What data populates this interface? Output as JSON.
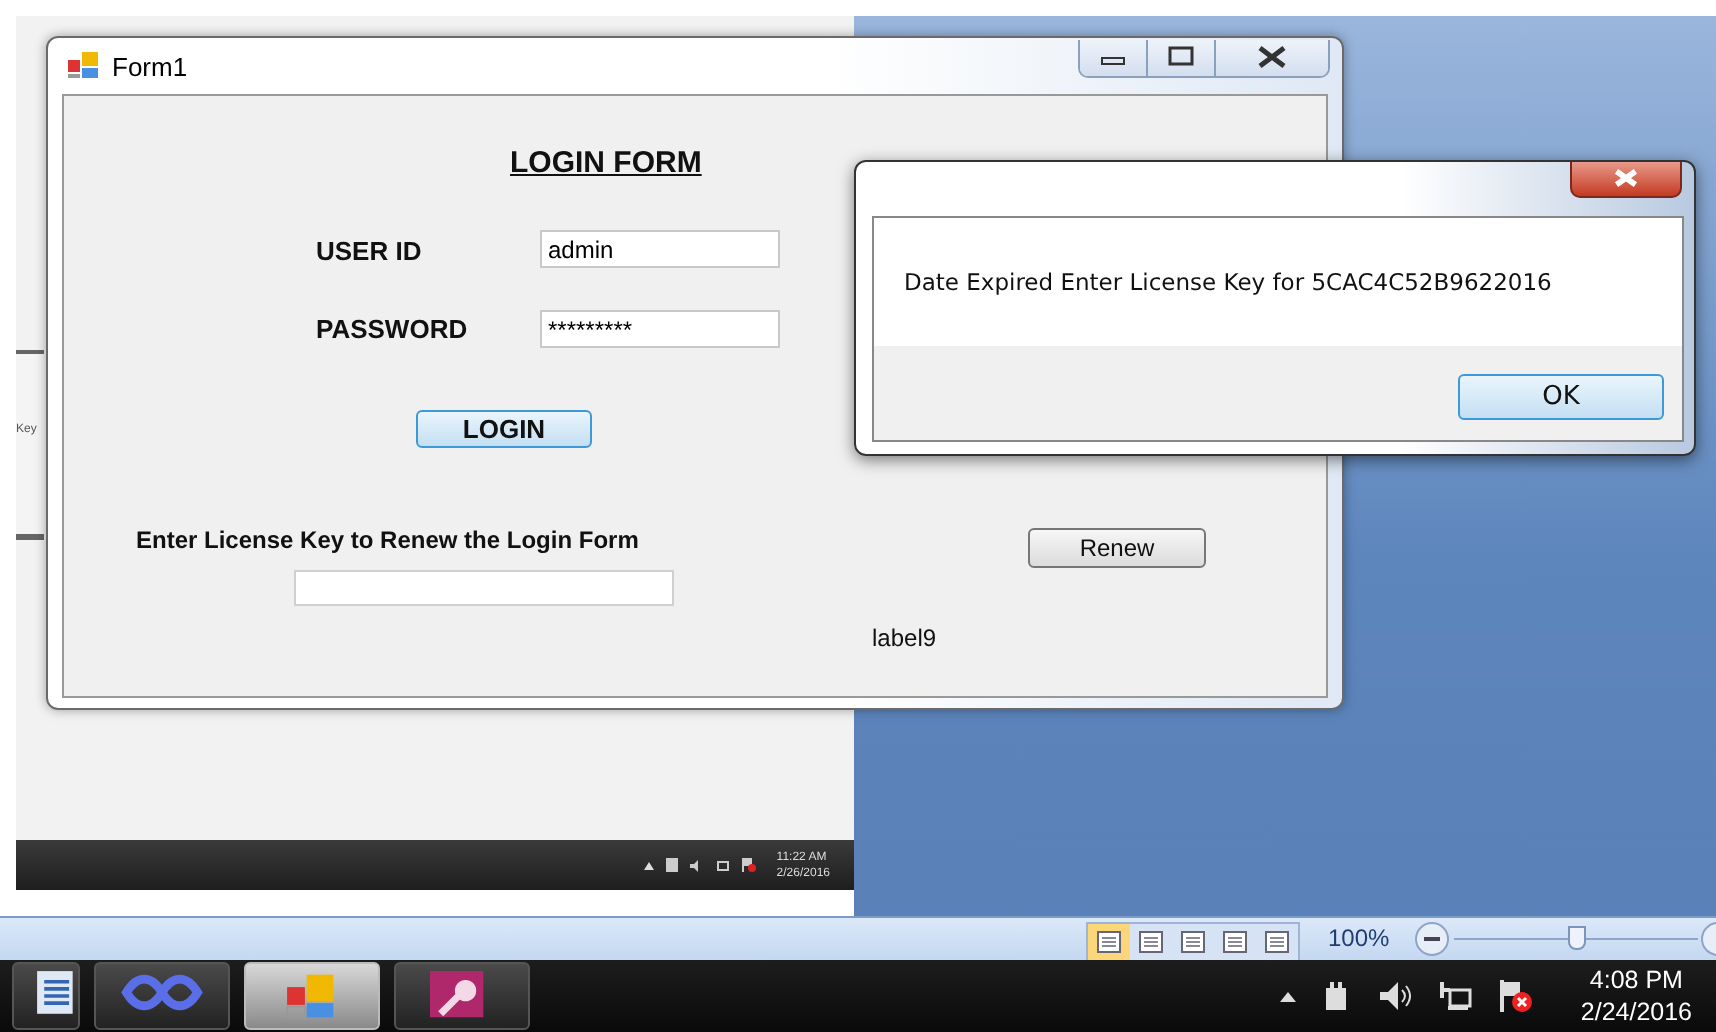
{
  "inner_screenshot": {
    "partial_window": {
      "label": "Key"
    },
    "taskbar": {
      "time": "11:22 AM",
      "date": "2/26/2016"
    }
  },
  "form_window": {
    "title": "Form1",
    "heading": "LOGIN FORM",
    "fields": [
      {
        "label": "USER ID",
        "value": "admin"
      },
      {
        "label": "PASSWORD",
        "value": "*********"
      }
    ],
    "login_button": "LOGIN",
    "license_prompt": "Enter License Key to Renew the Login Form",
    "renew_button": "Renew",
    "status_label": "label9"
  },
  "message_box": {
    "message": "Date Expired Enter License Key for 5CAC4C52B9622016",
    "button": "OK"
  },
  "word_status_bar": {
    "views": [
      {
        "selected": true
      },
      {
        "selected": false
      },
      {
        "selected": false
      },
      {
        "selected": false
      },
      {
        "selected": false
      }
    ],
    "zoom": "100%",
    "zoom_slider": {
      "level": 0.5
    }
  },
  "taskbar": {
    "apps": [
      {
        "kind": "document",
        "selected": false
      },
      {
        "kind": "infinity",
        "selected": false
      },
      {
        "kind": "form",
        "selected": true
      },
      {
        "kind": "key",
        "selected": false
      }
    ],
    "time": "4:08 PM",
    "date": "2/24/2016"
  }
}
